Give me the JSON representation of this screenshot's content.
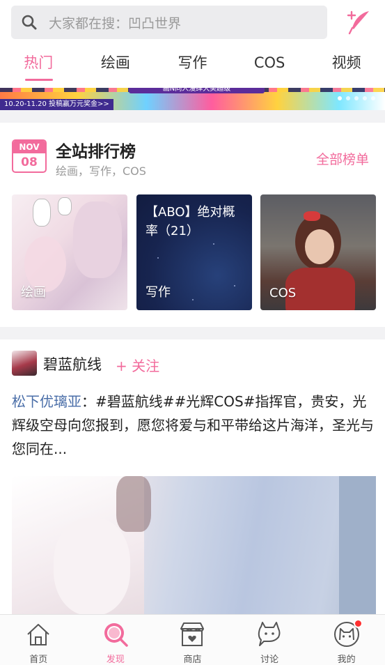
{
  "search": {
    "placeholder": "大家都在搜：凹凸世界",
    "icon": "search-icon"
  },
  "header": {
    "publish_icon": "quill-icon"
  },
  "tabs": [
    {
      "label": "热门",
      "active": true
    },
    {
      "label": "绘画",
      "active": false
    },
    {
      "label": "写作",
      "active": false
    },
    {
      "label": "COS",
      "active": false
    },
    {
      "label": "视频",
      "active": false
    }
  ],
  "banner": {
    "headline": "画N同人漫绎大奖超级",
    "caption": "10.20-11.20 投稿赢万元奖金>>",
    "slides": 5,
    "active_slide": 1
  },
  "ranking": {
    "date_month": "NOV",
    "date_day": "08",
    "title": "全站排行榜",
    "subtitle": "绘画，写作，COS",
    "all_link": "全部榜单",
    "items": [
      {
        "label": "绘画",
        "title": ""
      },
      {
        "label": "写作",
        "title": "【ABO】绝对概率（21）"
      },
      {
        "label": "COS",
        "title": ""
      }
    ]
  },
  "post": {
    "channel": "碧蓝航线",
    "follow_label": "+ 关注",
    "author": "松下优璃亚",
    "text": "：#碧蓝航线##光辉COS#指挥官，贵安，光辉级空母向您报到，愿您将爱与和平带给这片海洋，圣光与您同在..."
  },
  "bottom_nav": [
    {
      "label": "首页",
      "icon": "home-icon",
      "active": false
    },
    {
      "label": "发现",
      "icon": "discover-icon",
      "active": true
    },
    {
      "label": "商店",
      "icon": "shop-icon",
      "active": false
    },
    {
      "label": "讨论",
      "icon": "discussion-icon",
      "active": false
    },
    {
      "label": "我的",
      "icon": "profile-icon",
      "active": false,
      "has_notification": true
    }
  ],
  "colors": {
    "accent": "#f26b9c",
    "author_link": "#4a6ea8",
    "notification": "#ff3030"
  }
}
